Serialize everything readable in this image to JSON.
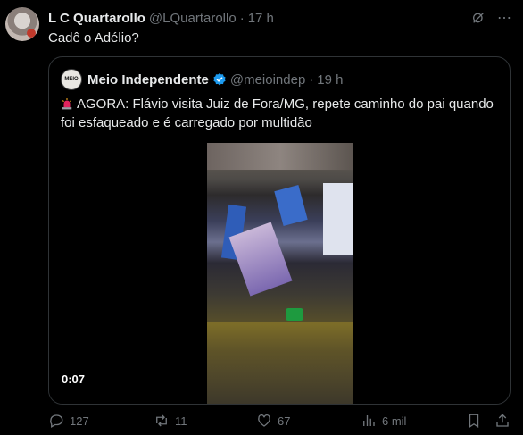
{
  "tweet": {
    "author_name": "L C Quartarollo",
    "author_handle": "@LQuartarollo",
    "separator": "·",
    "time": "17 h",
    "more_icon": "⋯",
    "text": "Cadê o Adélio?"
  },
  "quoted": {
    "avatar_text": "MEIO",
    "author_name": "Meio Independente",
    "author_handle": "@meioindep",
    "separator": "·",
    "time": "19 h",
    "text": "AGORA: Flávio visita Juiz de Fora/MG, repete caminho do pai quando foi esfaqueado e é carregado por multidão",
    "video_duration": "0:07"
  },
  "actions": {
    "replies": "127",
    "reposts": "11",
    "likes": "67",
    "views": "6 mil"
  },
  "colors": {
    "background": "#000000",
    "text": "#e7e9ea",
    "muted": "#71767b",
    "border": "#2f3336",
    "verified": "#1d9bf0"
  }
}
